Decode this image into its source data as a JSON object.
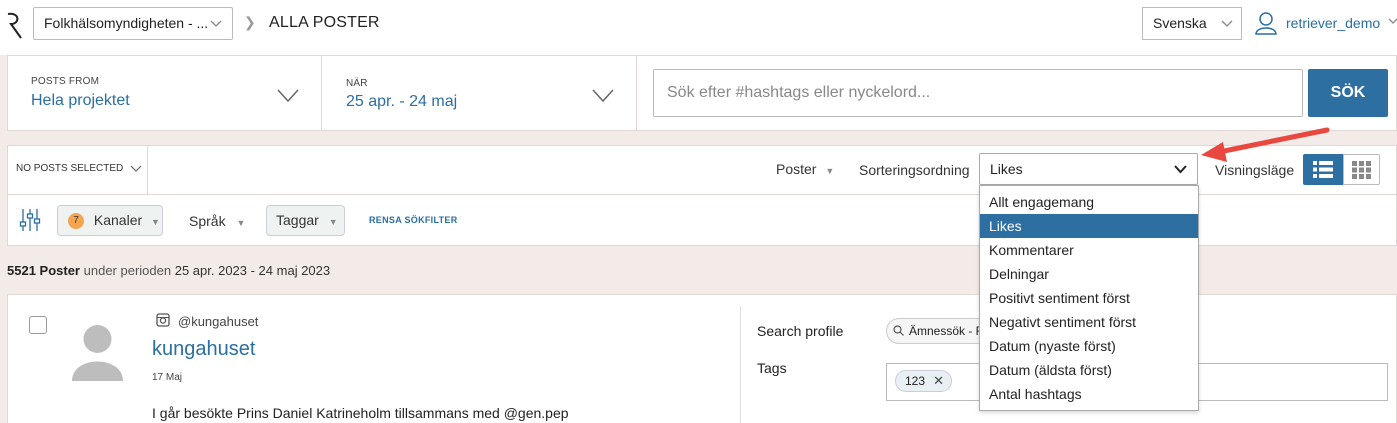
{
  "header": {
    "project_select": "Folkhälsomyndigheten - ...",
    "breadcrumb": "ALLA POSTER",
    "language": "Svenska",
    "username": "retriever_demo"
  },
  "filters": {
    "posts_from_label": "POSTS FROM",
    "posts_from_value": "Hela projektet",
    "when_label": "NÄR",
    "when_value": "25 apr. - 24 maj",
    "search_placeholder": "Sök efter #hashtags eller nyckelord...",
    "search_button": "SÖK"
  },
  "toolbar": {
    "no_posts_selected": "NO POSTS SELECTED",
    "posts_label": "Poster",
    "sort_label": "Sorteringsordning",
    "sort_value": "Likes",
    "view_label": "Visningsläge"
  },
  "filterbar": {
    "channels_count": "7",
    "channels": "Kanaler",
    "language": "Språk",
    "tags": "Taggar",
    "clear": "RENSA SÖKFILTER"
  },
  "results": {
    "count": "5521 Poster",
    "period_prefix": "under perioden",
    "period": "25 apr. 2023 - 24 maj 2023"
  },
  "post": {
    "handle": "@kungahuset",
    "name": "kungahuset",
    "date": "17 Maj",
    "text": "I går besökte Prins Daniel Katrineholm tillsammans med @gen.pep",
    "search_profile_label": "Search profile",
    "search_profile_value": "Ämnessök - F",
    "tags_label": "Tags",
    "tag": "123"
  },
  "sort_options": [
    "Allt engagemang",
    "Likes",
    "Kommentarer",
    "Delningar",
    "Positivt sentiment först",
    "Negativt sentiment först",
    "Datum (nyaste först)",
    "Datum (äldsta först)",
    "Antal hashtags"
  ],
  "colors": {
    "accent": "#2e6fa2",
    "annotation_arrow": "#e8483f"
  }
}
